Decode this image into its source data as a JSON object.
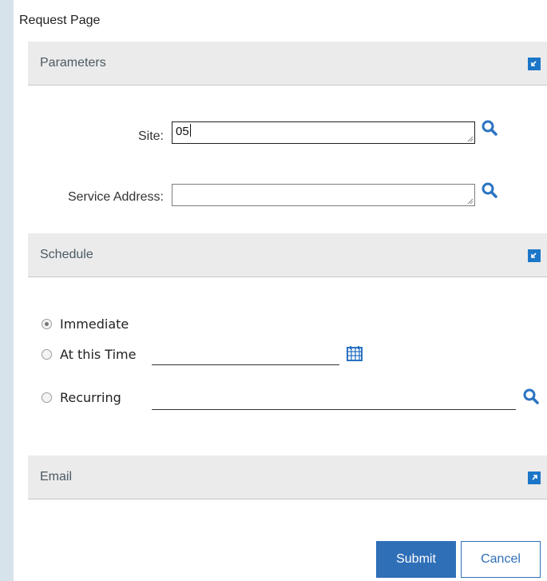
{
  "page": {
    "title": "Request Page"
  },
  "sections": {
    "parameters": {
      "title": "Parameters"
    },
    "schedule": {
      "title": "Schedule"
    },
    "email": {
      "title": "Email"
    }
  },
  "fields": {
    "site": {
      "label": "Site:",
      "value": "05"
    },
    "service_address": {
      "label": "Service Address:",
      "value": ""
    }
  },
  "schedule": {
    "options": [
      {
        "label": "Immediate",
        "checked": true
      },
      {
        "label": "At this Time",
        "checked": false
      },
      {
        "label": "Recurring",
        "checked": false
      }
    ]
  },
  "buttons": {
    "submit": "Submit",
    "cancel": "Cancel"
  },
  "colors": {
    "accent": "#1c76c8",
    "primary_button": "#2f6fb8",
    "header_bg": "#ebebeb"
  },
  "icons": [
    "collapse-icon",
    "expand-icon",
    "search-icon",
    "calendar-icon",
    "resize-grip-icon"
  ]
}
